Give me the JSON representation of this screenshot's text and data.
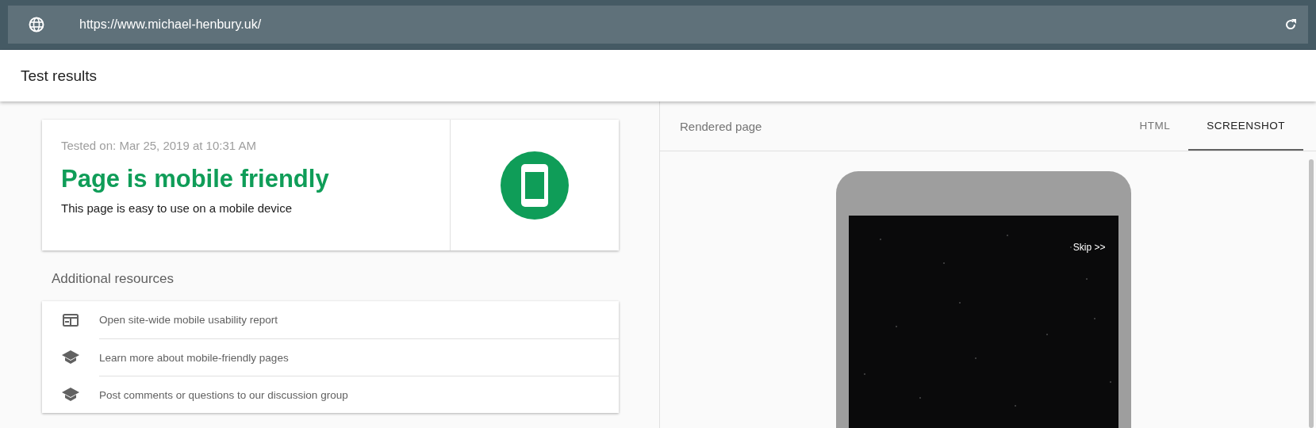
{
  "address_bar": {
    "url": "https://www.michael-henbury.uk/"
  },
  "header": {
    "title": "Test results"
  },
  "result": {
    "tested_on": "Tested on: Mar 25, 2019 at 10:31 AM",
    "verdict": "Page is mobile friendly",
    "description": "This page is easy to use on a mobile device"
  },
  "resources": {
    "title": "Additional resources",
    "items": [
      {
        "kind": "report",
        "label": "Open site-wide mobile usability report"
      },
      {
        "kind": "learn",
        "label": "Learn more about mobile-friendly pages"
      },
      {
        "kind": "learn",
        "label": "Post comments or questions to our discussion group"
      }
    ]
  },
  "rendered_page": {
    "title": "Rendered page",
    "tabs": [
      {
        "label": "HTML",
        "selected": false
      },
      {
        "label": "SCREENSHOT",
        "selected": true
      }
    ],
    "screenshot": {
      "skip_link": "Skip >>"
    }
  }
}
